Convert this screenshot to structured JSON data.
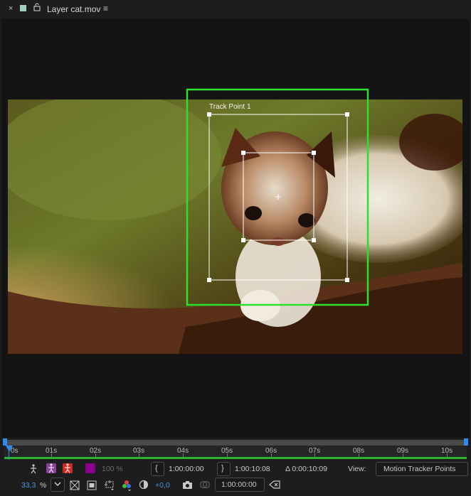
{
  "panel": {
    "title": "Layer cat.mov",
    "close_glyph": "×",
    "menu_glyph": "≡",
    "swatch_color": "#9fd0c4"
  },
  "tracker": {
    "label": "Track Point 1",
    "active_color": "#2ee02e"
  },
  "timeline": {
    "ticks": [
      "0s",
      "01s",
      "02s",
      "03s",
      "04s",
      "05s",
      "06s",
      "07s",
      "08s",
      "09s",
      "10s"
    ],
    "accent_color": "#2d8ceb",
    "work_area_color": "#2db52d"
  },
  "controls": {
    "opacity": "100 %",
    "in_point": "1:00:00:00",
    "out_point": "1:00:10:08",
    "duration": "Δ 0:00:10:09",
    "view_label": "View:",
    "view_value": "Motion Tracker Points",
    "zoom_value": "33,3",
    "zoom_unit": "%",
    "exposure": "+0,0",
    "current_time": "1:00:00:00"
  }
}
